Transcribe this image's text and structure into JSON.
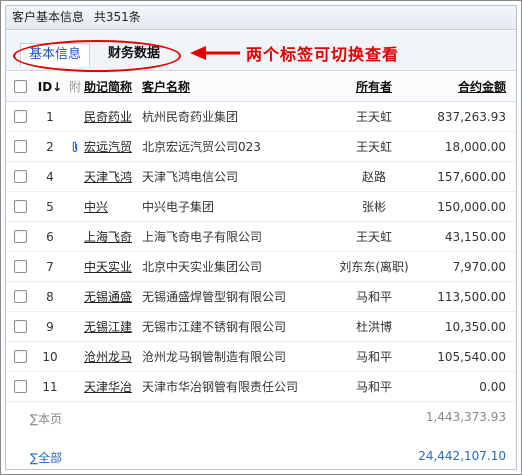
{
  "window": {
    "title": "客户基本信息",
    "count": "共351条"
  },
  "tabs": [
    {
      "label": "基本信息",
      "active": true
    },
    {
      "label": "财务数据",
      "active": false
    }
  ],
  "annotation": {
    "text": "两个标签可切换查看",
    "color": "#e00000"
  },
  "table": {
    "headers": {
      "id": "ID↓",
      "attachment": "附",
      "code": "助记简称",
      "name": "客户名称",
      "owner": "所有者",
      "amount": "合约金额"
    },
    "rows": [
      {
        "id": "1",
        "attachment": "",
        "code": "民奇药业",
        "name": "杭州民奇药业集团",
        "owner": "王天虹",
        "amount": "837,263.93"
      },
      {
        "id": "2",
        "attachment": "paperclip",
        "code": "宏远汽贸",
        "name": "北京宏远汽贸公司023",
        "owner": "王天虹",
        "amount": "18,000.00"
      },
      {
        "id": "4",
        "attachment": "",
        "code": "天津飞鸿",
        "name": "天津飞鸿电信公司",
        "owner": "赵路",
        "amount": "157,600.00"
      },
      {
        "id": "5",
        "attachment": "",
        "code": "中兴",
        "name": "中兴电子集团",
        "owner": "张彬",
        "amount": "150,000.00"
      },
      {
        "id": "6",
        "attachment": "",
        "code": "上海飞奇",
        "name": "上海飞奇电子有限公司",
        "owner": "王天虹",
        "amount": "43,150.00"
      },
      {
        "id": "7",
        "attachment": "",
        "code": "中天实业",
        "name": "北京中天实业集团公司",
        "owner": "刘东东(离职)",
        "amount": "7,970.00"
      },
      {
        "id": "8",
        "attachment": "",
        "code": "无锡通盛",
        "name": "无锡通盛焊管型钢有限公司",
        "owner": "马和平",
        "amount": "113,500.00"
      },
      {
        "id": "9",
        "attachment": "",
        "code": "无锡江建",
        "name": "无锡市江建不锈钢有限公司",
        "owner": "杜洪博",
        "amount": "10,350.00"
      },
      {
        "id": "10",
        "attachment": "",
        "code": "沧州龙马",
        "name": "沧州龙马钢管制造有限公司",
        "owner": "马和平",
        "amount": "105,540.00"
      },
      {
        "id": "11",
        "attachment": "",
        "code": "天津华冶",
        "name": "天津市华冶钢管有限责任公司",
        "owner": "马和平",
        "amount": "0.00"
      }
    ]
  },
  "summary": {
    "page_label": "∑本页",
    "page_total": "1,443,373.93",
    "all_label": "∑全部",
    "all_total": "24,442,107.10"
  }
}
